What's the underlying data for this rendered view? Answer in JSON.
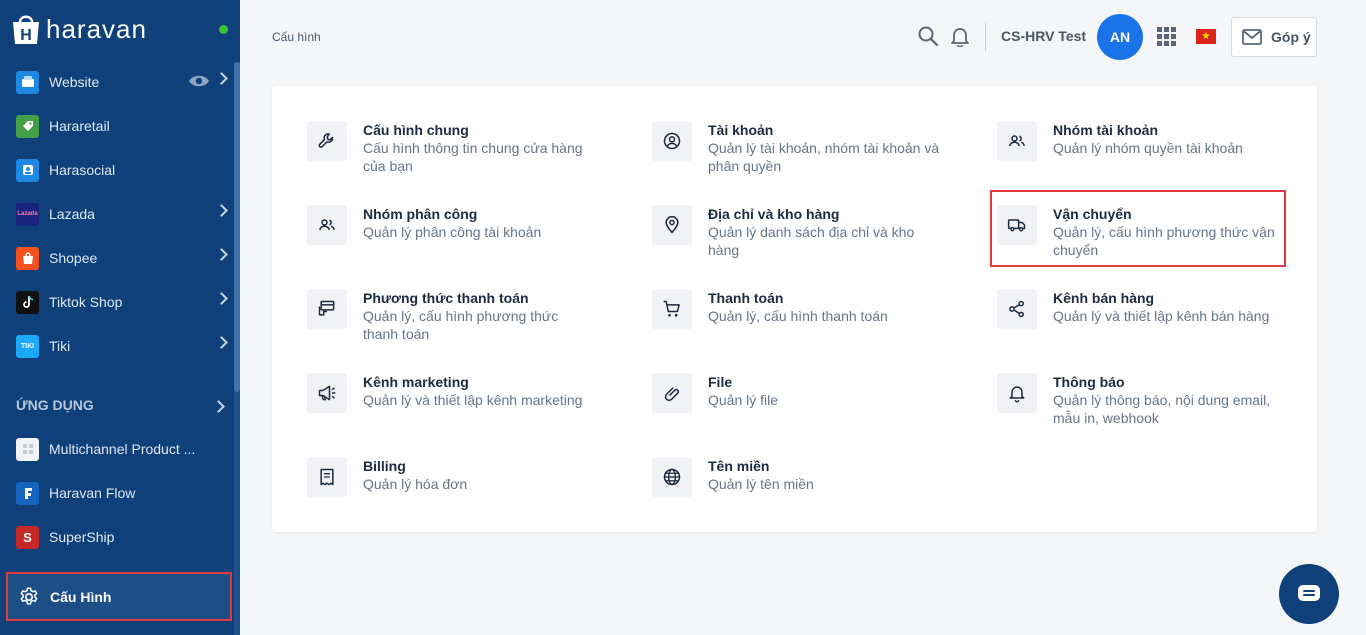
{
  "brand": {
    "name": "haravan"
  },
  "sidebar": {
    "items": [
      {
        "label": "Website",
        "icon": "website-icon",
        "color": "#1e88e5"
      },
      {
        "label": "Hararetail",
        "icon": "hararetail-icon",
        "color": "#43a047"
      },
      {
        "label": "Harasocial",
        "icon": "harasocial-icon",
        "color": "#1e88e5"
      },
      {
        "label": "Lazada",
        "icon": "lazada-icon",
        "color": "#1a237e",
        "badge": "Lazada"
      },
      {
        "label": "Shopee",
        "icon": "shopee-icon",
        "color": "#f4511e"
      },
      {
        "label": "Tiktok Shop",
        "icon": "tiktok-icon",
        "color": "#111111"
      },
      {
        "label": "Tiki",
        "icon": "tiki-icon",
        "color": "#1ba8ff",
        "badge": "TIKI"
      }
    ],
    "section_label": "ỨNG DỤNG",
    "apps": [
      {
        "label": "Multichannel Product ...",
        "icon": "multichannel-icon",
        "color": "#f1f3f6"
      },
      {
        "label": "Haravan Flow",
        "icon": "haravan-flow-icon",
        "color": "#1565c0"
      },
      {
        "label": "SuperShip",
        "icon": "supership-icon",
        "color": "#c62828"
      }
    ],
    "active": {
      "label": "Cấu Hình",
      "icon": "gear-icon"
    }
  },
  "header": {
    "breadcrumb": "Cấu hình",
    "store_name": "CS-HRV Test",
    "avatar_initials": "AN",
    "feedback_label": "Góp ý"
  },
  "settings": [
    {
      "title": "Cấu hình chung",
      "desc": "Cấu hình thông tin chung cửa hàng của bạn",
      "icon": "wrench-icon"
    },
    {
      "title": "Tài khoản",
      "desc": "Quản lý tài khoản, nhóm tài khoản và phân quyền",
      "icon": "account-icon"
    },
    {
      "title": "Nhóm tài khoản",
      "desc": "Quản lý nhóm quyền tài khoản",
      "icon": "account-group-icon"
    },
    {
      "title": "Nhóm phân công",
      "desc": "Quản lý phân công tài khoản",
      "icon": "assignment-group-icon"
    },
    {
      "title": "Địa chỉ và kho hàng",
      "desc": "Quản lý danh sách địa chỉ và kho hàng",
      "icon": "location-pin-icon"
    },
    {
      "title": "Vận chuyển",
      "desc": "Quản lý, cấu hình phương thức vận chuyển",
      "icon": "truck-icon"
    },
    {
      "title": "Phương thức thanh toán",
      "desc": "Quản lý, cấu hình phương thức thanh toán",
      "icon": "payment-method-icon"
    },
    {
      "title": "Thanh toán",
      "desc": "Quản lý, cấu hình thanh toán",
      "icon": "cart-icon"
    },
    {
      "title": "Kênh bán hàng",
      "desc": "Quản lý và thiết lập kênh bán hàng",
      "icon": "share-icon"
    },
    {
      "title": "Kênh marketing",
      "desc": "Quản lý và thiết lập kênh marketing",
      "icon": "megaphone-icon"
    },
    {
      "title": "File",
      "desc": "Quản lý file",
      "icon": "paperclip-icon"
    },
    {
      "title": "Thông báo",
      "desc": "Quản lý thông báo, nội dung email, mẫu in, webhook",
      "icon": "bell-icon"
    },
    {
      "title": "Billing",
      "desc": "Quản lý hóa đơn",
      "icon": "receipt-icon"
    },
    {
      "title": "Tên miền",
      "desc": "Quản lý tên miền",
      "icon": "globe-icon"
    }
  ]
}
